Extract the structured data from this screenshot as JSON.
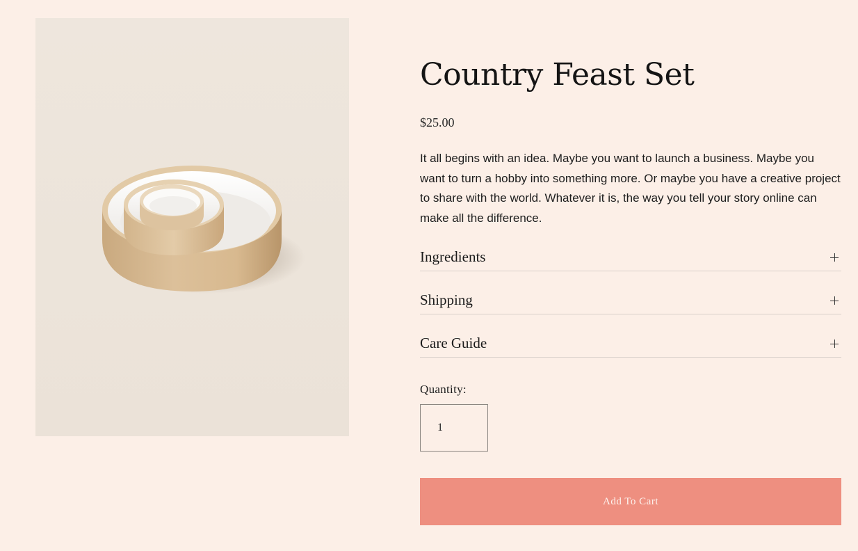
{
  "product": {
    "title": "Country Feast Set",
    "price": "$25.00",
    "description": "It all begins with an idea. Maybe you want to launch a business. Maybe you want to turn a hobby into something more. Or maybe you have a creative project to share with the world. Whatever it is, the way you tell your story online can make all the difference.",
    "image_icon": "nested-ceramic-bowls-image"
  },
  "accordions": [
    {
      "label": "Ingredients",
      "icon": "plus-icon"
    },
    {
      "label": "Shipping",
      "icon": "plus-icon"
    },
    {
      "label": "Care Guide",
      "icon": "plus-icon"
    }
  ],
  "quantity": {
    "label": "Quantity:",
    "value": "1"
  },
  "cart": {
    "add_label": "Add To Cart"
  },
  "colors": {
    "background": "#fcefe7",
    "accent": "#ee8f80",
    "image_bg": "#ece4da"
  }
}
